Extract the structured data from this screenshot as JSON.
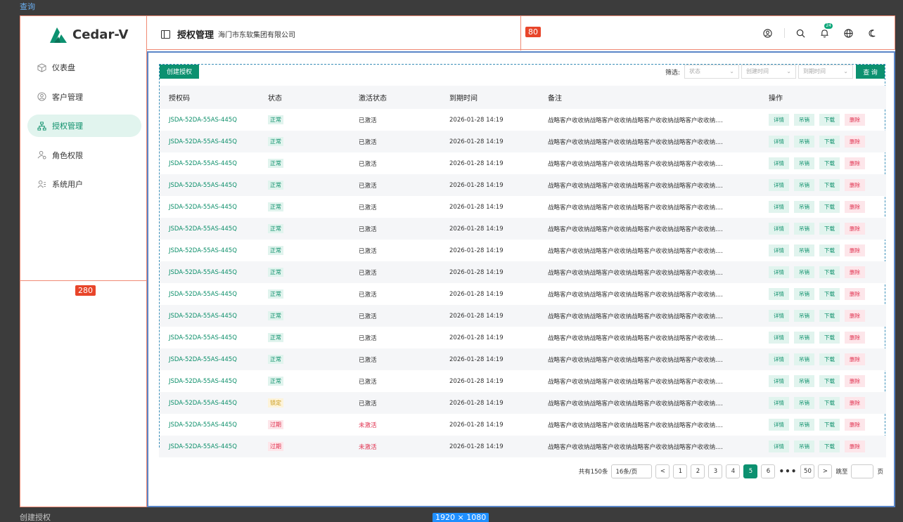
{
  "captions": {
    "top": "查询",
    "bottom": "创建授权",
    "size_badge": "1920 × 1080"
  },
  "annotations": {
    "sidebar_width": "280",
    "header_height": "80"
  },
  "brand": {
    "name": "Cedar-V",
    "color": "#0c9170"
  },
  "sidebar": {
    "items": [
      {
        "label": "仪表盘",
        "icon": "cube-icon",
        "active": false
      },
      {
        "label": "客户管理",
        "icon": "user-circle-icon",
        "active": false
      },
      {
        "label": "授权管理",
        "icon": "org-tree-icon",
        "active": true
      },
      {
        "label": "角色权限",
        "icon": "user-gear-icon",
        "active": false
      },
      {
        "label": "系统用户",
        "icon": "user-list-icon",
        "active": false
      }
    ]
  },
  "header": {
    "title": "授权管理",
    "subtitle": "海门市东软集团有限公司",
    "notification_count": "24",
    "icons": [
      "account-icon",
      "search-icon",
      "bell-icon",
      "globe-icon",
      "theme-icon"
    ]
  },
  "toolbar": {
    "create_label": "创建授权",
    "filter_label": "筛选:",
    "status_placeholder": "状态",
    "created_placeholder": "创建时间",
    "expire_placeholder": "到期时间",
    "query_label": "查 询"
  },
  "table": {
    "columns": [
      "授权码",
      "状态",
      "激活状态",
      "到期时间",
      "备注",
      "操作"
    ],
    "actions": {
      "detail": "详情",
      "revoke": "吊销",
      "download": "下载",
      "delete": "删除"
    },
    "rows": [
      {
        "code": "JSDA-52DA-55AS-445Q",
        "status": "正常",
        "status_type": "normal",
        "activation": "已激活",
        "inactive": false,
        "expires": "2026-01-28 14:19",
        "note": "战略客户收收纳战略客户收收纳战略客户收收纳战略客户收收纳...."
      },
      {
        "code": "JSDA-52DA-55AS-445Q",
        "status": "正常",
        "status_type": "normal",
        "activation": "已激活",
        "inactive": false,
        "expires": "2026-01-28 14:19",
        "note": "战略客户收收纳战略客户收收纳战略客户收收纳战略客户收收纳...."
      },
      {
        "code": "JSDA-52DA-55AS-445Q",
        "status": "正常",
        "status_type": "normal",
        "activation": "已激活",
        "inactive": false,
        "expires": "2026-01-28 14:19",
        "note": "战略客户收收纳战略客户收收纳战略客户收收纳战略客户收收纳...."
      },
      {
        "code": "JSDA-52DA-55AS-445Q",
        "status": "正常",
        "status_type": "normal",
        "activation": "已激活",
        "inactive": false,
        "expires": "2026-01-28 14:19",
        "note": "战略客户收收纳战略客户收收纳战略客户收收纳战略客户收收纳...."
      },
      {
        "code": "JSDA-52DA-55AS-445Q",
        "status": "正常",
        "status_type": "normal",
        "activation": "已激活",
        "inactive": false,
        "expires": "2026-01-28 14:19",
        "note": "战略客户收收纳战略客户收收纳战略客户收收纳战略客户收收纳...."
      },
      {
        "code": "JSDA-52DA-55AS-445Q",
        "status": "正常",
        "status_type": "normal",
        "activation": "已激活",
        "inactive": false,
        "expires": "2026-01-28 14:19",
        "note": "战略客户收收纳战略客户收收纳战略客户收收纳战略客户收收纳...."
      },
      {
        "code": "JSDA-52DA-55AS-445Q",
        "status": "正常",
        "status_type": "normal",
        "activation": "已激活",
        "inactive": false,
        "expires": "2026-01-28 14:19",
        "note": "战略客户收收纳战略客户收收纳战略客户收收纳战略客户收收纳...."
      },
      {
        "code": "JSDA-52DA-55AS-445Q",
        "status": "正常",
        "status_type": "normal",
        "activation": "已激活",
        "inactive": false,
        "expires": "2026-01-28 14:19",
        "note": "战略客户收收纳战略客户收收纳战略客户收收纳战略客户收收纳...."
      },
      {
        "code": "JSDA-52DA-55AS-445Q",
        "status": "正常",
        "status_type": "normal",
        "activation": "已激活",
        "inactive": false,
        "expires": "2026-01-28 14:19",
        "note": "战略客户收收纳战略客户收收纳战略客户收收纳战略客户收收纳...."
      },
      {
        "code": "JSDA-52DA-55AS-445Q",
        "status": "正常",
        "status_type": "normal",
        "activation": "已激活",
        "inactive": false,
        "expires": "2026-01-28 14:19",
        "note": "战略客户收收纳战略客户收收纳战略客户收收纳战略客户收收纳...."
      },
      {
        "code": "JSDA-52DA-55AS-445Q",
        "status": "正常",
        "status_type": "normal",
        "activation": "已激活",
        "inactive": false,
        "expires": "2026-01-28 14:19",
        "note": "战略客户收收纳战略客户收收纳战略客户收收纳战略客户收收纳...."
      },
      {
        "code": "JSDA-52DA-55AS-445Q",
        "status": "正常",
        "status_type": "normal",
        "activation": "已激活",
        "inactive": false,
        "expires": "2026-01-28 14:19",
        "note": "战略客户收收纳战略客户收收纳战略客户收收纳战略客户收收纳...."
      },
      {
        "code": "JSDA-52DA-55AS-445Q",
        "status": "正常",
        "status_type": "normal",
        "activation": "已激活",
        "inactive": false,
        "expires": "2026-01-28 14:19",
        "note": "战略客户收收纳战略客户收收纳战略客户收收纳战略客户收收纳...."
      },
      {
        "code": "JSDA-52DA-55AS-445Q",
        "status": "锁定",
        "status_type": "locked",
        "activation": "已激活",
        "inactive": false,
        "expires": "2026-01-28 14:19",
        "note": "战略客户收收纳战略客户收收纳战略客户收收纳战略客户收收纳...."
      },
      {
        "code": "JSDA-52DA-55AS-445Q",
        "status": "过期",
        "status_type": "expired",
        "activation": "未激活",
        "inactive": true,
        "expires": "2026-01-28 14:19",
        "note": "战略客户收收纳战略客户收收纳战略客户收收纳战略客户收收纳...."
      },
      {
        "code": "JSDA-52DA-55AS-445Q",
        "status": "过期",
        "status_type": "expired",
        "activation": "未激活",
        "inactive": true,
        "expires": "2026-01-28 14:19",
        "note": "战略客户收收纳战略客户收收纳战略客户收收纳战略客户收收纳...."
      }
    ]
  },
  "pagination": {
    "total": "共有150条",
    "page_size": "16条/页",
    "prev": "<",
    "next": ">",
    "pages": [
      "1",
      "2",
      "3",
      "4",
      "5",
      "6"
    ],
    "current": "5",
    "ellipsis": "•••",
    "last": "50",
    "jump_label": "跳至",
    "page_suffix": "页"
  }
}
